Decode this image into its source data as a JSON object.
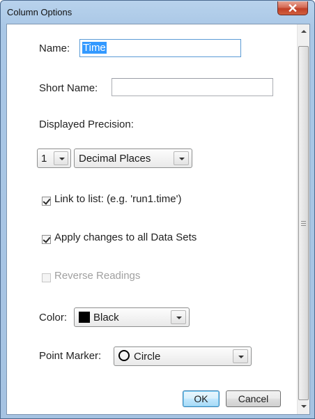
{
  "window": {
    "title": "Column Options",
    "close_glyph": "x"
  },
  "form": {
    "name_label": "Name:",
    "name_value": "Time",
    "short_name_label": "Short Name:",
    "short_name_value": "",
    "precision_label": "Displayed Precision:",
    "precision_value": "1",
    "precision_type": "Decimal Places",
    "link_label": "Link to list: (e.g. 'run1.time')",
    "link_checked": true,
    "apply_label": "Apply changes to all Data Sets",
    "apply_checked": true,
    "reverse_label": "Reverse Readings",
    "reverse_checked": false,
    "reverse_disabled": true,
    "color_label": "Color:",
    "color_value": "Black",
    "color_hex": "#000000",
    "marker_label": "Point Marker:",
    "marker_value": "Circle",
    "marker_icon": "circle-icon"
  },
  "buttons": {
    "ok": "OK",
    "cancel": "Cancel"
  },
  "colors": {
    "selection": "#3399ff",
    "default_button_border": "#3c7fb1",
    "close_button": "#c13f26"
  }
}
